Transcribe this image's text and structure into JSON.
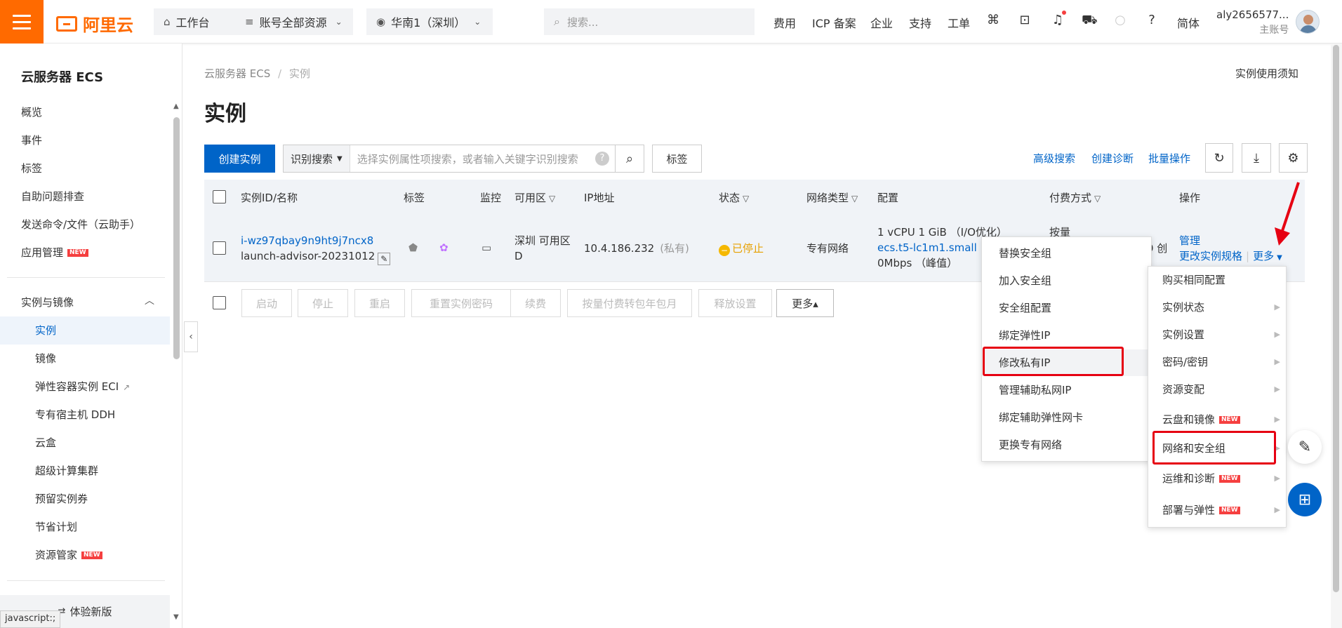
{
  "topbar": {
    "brand": "阿里云",
    "workbench": "工作台",
    "account_resources": "账号全部资源",
    "region": "华南1（深圳）",
    "search_placeholder": "搜索...",
    "links": [
      "费用",
      "ICP 备案",
      "企业",
      "支持",
      "工单"
    ],
    "lang": "简体",
    "user_name": "aly2656577...",
    "user_role": "主账号"
  },
  "sidebar": {
    "title": "云服务器 ECS",
    "items": [
      "概览",
      "事件",
      "标签",
      "自助问题排查",
      "发送命令/文件（云助手）",
      "应用管理"
    ],
    "group_title": "实例与镜像",
    "sub_items": [
      "实例",
      "镜像",
      "弹性容器实例 ECI",
      "专有宿主机 DDH",
      "云盒",
      "超级计算集群",
      "预留实例券",
      "节省计划",
      "资源管家"
    ],
    "new_badge": "NEW",
    "footer": "体验新版",
    "status_tip": "javascript:;"
  },
  "page": {
    "breadcrumb": [
      "云服务器 ECS",
      "实例"
    ],
    "breadcrumb_sep": "/",
    "notice": "实例使用须知",
    "title": "实例"
  },
  "toolbar": {
    "create": "创建实例",
    "search_mode": "识别搜索",
    "search_placeholder": "选择实例属性项搜索，或者输入关键字识别搜索",
    "help": "?",
    "tag": "标签",
    "advanced_search": "高级搜索",
    "create_diagnosis": "创建诊断",
    "batch_ops": "批量操作"
  },
  "table": {
    "headers": [
      "实例ID/名称",
      "标签",
      "监控",
      "可用区",
      "IP地址",
      "状态",
      "网络类型",
      "配置",
      "付费方式",
      "操作"
    ],
    "row": {
      "id": "i-wz97qbay9n9ht9j7ncx8",
      "name": "launch-advisor-20231012",
      "zone": "深圳 可用区",
      "zone2": "D",
      "ip": "10.4.186.232",
      "ip_tag": "(私有)",
      "status": "已停止",
      "network": "专有网络",
      "config1": "1 vCPU 1 GiB （I/O优化）",
      "config2": "ecs.t5-lc1m1.small",
      "config3": "0Mbps （峰值）",
      "pay": "按量",
      "pay_extra": "9 创",
      "op_manage": "管理",
      "op_change": "更改实例规格",
      "op_sep": "|",
      "op_more": "更多"
    }
  },
  "bottom_actions": [
    "启动",
    "停止",
    "重启",
    "重置实例密码",
    "续费",
    "按量付费转包年包月",
    "释放设置",
    "更多▴"
  ],
  "submenu": [
    "替换安全组",
    "加入安全组",
    "安全组配置",
    "绑定弹性IP",
    "修改私有IP",
    "管理辅助私网IP",
    "绑定辅助弹性网卡",
    "更换专有网络"
  ],
  "more_menu": [
    "购买相同配置",
    "实例状态",
    "实例设置",
    "密码/密钥",
    "资源变配",
    "云盘和镜像",
    "网络和安全组",
    "运维和诊断",
    "部署与弹性"
  ],
  "colors": {
    "brand": "#ff6a00",
    "primary": "#0064c8",
    "highlight": "#e60012",
    "warning": "#f5b800"
  }
}
